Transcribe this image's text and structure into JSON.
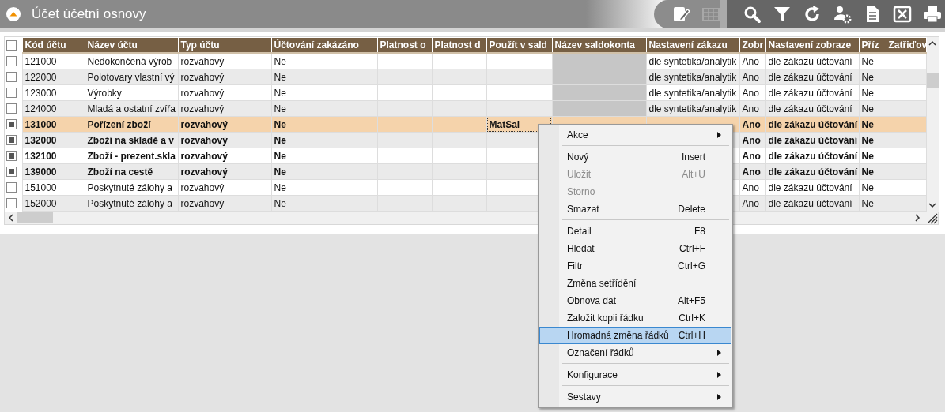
{
  "window": {
    "title": "Účet účetní osnovy"
  },
  "toolbar": [
    {
      "kind": "edit",
      "disabled": false
    },
    {
      "kind": "grid",
      "disabled": true
    },
    {
      "kind": "search",
      "disabled": false
    },
    {
      "kind": "filter",
      "disabled": false
    },
    {
      "kind": "refresh",
      "disabled": false
    },
    {
      "kind": "usergear",
      "disabled": false
    },
    {
      "kind": "document",
      "disabled": false
    },
    {
      "kind": "excel",
      "disabled": false
    },
    {
      "kind": "print",
      "disabled": false
    }
  ],
  "table": {
    "select_all_checked": false,
    "columns": [
      "Kód účtu",
      "Název účtu",
      "Typ účtu",
      "Účtování zakázáno",
      "Platnost o",
      "Platnost d",
      "Použít v sald",
      "Název saldokonta",
      "Nastavení zákazu",
      "Zobr",
      "Nastavení zobraze",
      "Příz",
      "Zatřiďov"
    ],
    "rows": [
      {
        "checked": false,
        "selected": false,
        "saldo_greyed": true,
        "focus_on_saldo_code": false,
        "kod": "121000",
        "nazev": "Nedokončená výrob",
        "typ": "rozvahový",
        "uctovani": "Ne",
        "zakaz": "dle syntetika/analytik",
        "zobr": "Ano",
        "zobrazeni": "dle zákazu účtování",
        "priz": "Ne"
      },
      {
        "checked": false,
        "selected": false,
        "saldo_greyed": true,
        "focus_on_saldo_code": false,
        "kod": "122000",
        "nazev": "Polotovary vlastní vý",
        "typ": "rozvahový",
        "uctovani": "Ne",
        "zakaz": "dle syntetika/analytik",
        "zobr": "Ano",
        "zobrazeni": "dle zákazu účtování",
        "priz": "Ne"
      },
      {
        "checked": false,
        "selected": false,
        "saldo_greyed": true,
        "focus_on_saldo_code": false,
        "kod": "123000",
        "nazev": "Výrobky",
        "typ": "rozvahový",
        "uctovani": "Ne",
        "zakaz": "dle syntetika/analytik",
        "zobr": "Ano",
        "zobrazeni": "dle zákazu účtování",
        "priz": "Ne"
      },
      {
        "checked": false,
        "selected": false,
        "saldo_greyed": true,
        "focus_on_saldo_code": false,
        "kod": "124000",
        "nazev": "Mladá a ostatní zvířa",
        "typ": "rozvahový",
        "uctovani": "Ne",
        "zakaz": "dle syntetika/analytik",
        "zobr": "Ano",
        "zobrazeni": "dle zákazu účtování",
        "priz": "Ne"
      },
      {
        "checked": true,
        "selected": true,
        "focus_on_saldo_code": true,
        "kod": "131000",
        "nazev": "Pořízení zboží",
        "typ": "rozvahový",
        "uctovani": "Ne",
        "pouzit": "MatSal",
        "zobr": "Ano",
        "zobrazeni": "dle zákazu účtování",
        "priz": "Ne"
      },
      {
        "checked": true,
        "selected": false,
        "focus_on_saldo_code": false,
        "kod": "132000",
        "nazev": "Zboží na skladě a v",
        "typ": "rozvahový",
        "uctovani": "Ne",
        "zobr": "Ano",
        "zobrazeni": "dle zákazu účtování",
        "priz": "Ne"
      },
      {
        "checked": true,
        "selected": false,
        "focus_on_saldo_code": false,
        "kod": "132100",
        "nazev": "Zboží - prezent.skla",
        "typ": "rozvahový",
        "uctovani": "Ne",
        "zobr": "Ano",
        "zobrazeni": "dle zákazu účtování",
        "priz": "Ne"
      },
      {
        "checked": true,
        "selected": false,
        "focus_on_saldo_code": false,
        "kod": "139000",
        "nazev": "Zboží na cestě",
        "typ": "rozvahový",
        "uctovani": "Ne",
        "zobr": "Ano",
        "zobrazeni": "dle zákazu účtování",
        "priz": "Ne"
      },
      {
        "checked": false,
        "selected": false,
        "focus_on_saldo_code": false,
        "kod": "151000",
        "nazev": "Poskytnuté zálohy a",
        "typ": "rozvahový",
        "uctovani": "Ne",
        "zobr": "Ano",
        "zobrazeni": "dle zákazu účtování",
        "priz": "Ne"
      },
      {
        "checked": false,
        "selected": false,
        "focus_on_saldo_code": false,
        "kod": "152000",
        "nazev": "Poskytnuté zálohy a",
        "typ": "rozvahový",
        "uctovani": "Ne",
        "zobr": "Ano",
        "zobrazeni": "dle zákazu účtování",
        "priz": "Ne"
      }
    ]
  },
  "context_menu": [
    {
      "kind": "submenu",
      "label": "Akce",
      "disabled": false,
      "selected": false
    },
    {
      "kind": "separator"
    },
    {
      "kind": "command",
      "label": "Nový",
      "shortcut": "Insert",
      "disabled": false,
      "selected": false
    },
    {
      "kind": "command",
      "label": "Uložit",
      "shortcut": "Alt+U",
      "disabled": true,
      "selected": false
    },
    {
      "kind": "command",
      "label": "Storno",
      "disabled": true,
      "selected": false
    },
    {
      "kind": "command",
      "label": "Smazat",
      "shortcut": "Delete",
      "disabled": false,
      "selected": false
    },
    {
      "kind": "separator"
    },
    {
      "kind": "command",
      "label": "Detail",
      "shortcut": "F8",
      "disabled": false,
      "selected": false
    },
    {
      "kind": "command",
      "label": "Hledat",
      "shortcut": "Ctrl+F",
      "disabled": false,
      "selected": false
    },
    {
      "kind": "command",
      "label": "Filtr",
      "shortcut": "Ctrl+G",
      "disabled": false,
      "selected": false
    },
    {
      "kind": "command",
      "label": "Změna setřídění",
      "disabled": false,
      "selected": false
    },
    {
      "kind": "command",
      "label": "Obnova dat",
      "shortcut": "Alt+F5",
      "disabled": false,
      "selected": false
    },
    {
      "kind": "command",
      "label": "Založit kopii řádku",
      "shortcut": "Ctrl+K",
      "disabled": false,
      "selected": false
    },
    {
      "kind": "command",
      "label": "Hromadná změna řádků",
      "shortcut": "Ctrl+H",
      "disabled": false,
      "selected": true
    },
    {
      "kind": "submenu",
      "label": "Označení řádků",
      "disabled": false,
      "selected": false
    },
    {
      "kind": "separator"
    },
    {
      "kind": "submenu",
      "label": "Konfigurace",
      "disabled": false,
      "selected": false
    },
    {
      "kind": "separator"
    },
    {
      "kind": "submenu",
      "label": "Sestavy",
      "disabled": false,
      "selected": false
    }
  ]
}
